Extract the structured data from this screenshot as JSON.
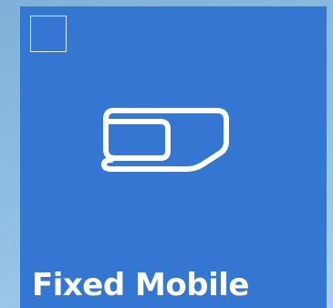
{
  "tile": {
    "label": "Fixed Mobile",
    "icon": "sim-card-icon",
    "selected": false,
    "colors": {
      "tile_background": "#3377d2",
      "foreground": "#ffffff",
      "desktop_background": "#8dbde2"
    }
  }
}
